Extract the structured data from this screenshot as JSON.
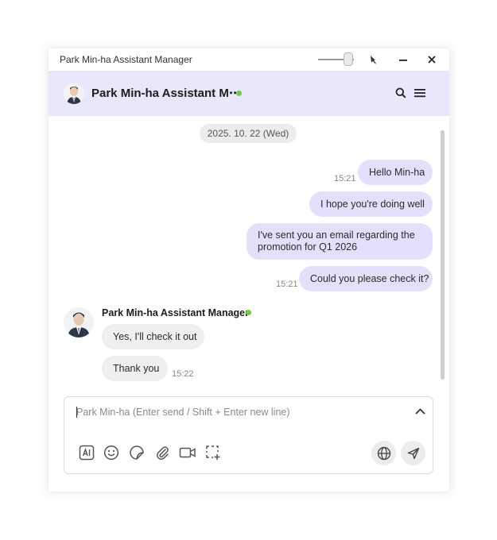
{
  "window": {
    "title": "Park Min-ha Assistant Manager"
  },
  "chat_header": {
    "contact_name": "Park Min-ha Assistant M⋯",
    "status_color": "#6fcf3f",
    "accent_color": "#e9e7fb"
  },
  "messages": {
    "date_divider": "2025. 10. 22 (Wed)",
    "outgoing": [
      {
        "text": "Hello Min-ha",
        "time": "15:21"
      },
      {
        "text": "I hope you're doing well",
        "time": ""
      },
      {
        "text": "I've sent you an email regarding the promotion for Q1 2026",
        "time": ""
      },
      {
        "text": "Could you please check it?",
        "time": "15:21"
      }
    ],
    "sender_name": "Park Min-ha Assistant Manager",
    "incoming": [
      {
        "text": "Yes, I'll check it out",
        "time": ""
      },
      {
        "text": "Thank you",
        "time": "15:22"
      }
    ]
  },
  "composer": {
    "placeholder": "Park Min-ha (Enter send / Shift + Enter new line)",
    "value": "",
    "tools": [
      "ai-icon",
      "emoji-icon",
      "sticker-icon",
      "attachment-icon",
      "video-call-icon",
      "screen-capture-icon"
    ],
    "actions": [
      "translate-globe-icon",
      "send-icon"
    ]
  }
}
